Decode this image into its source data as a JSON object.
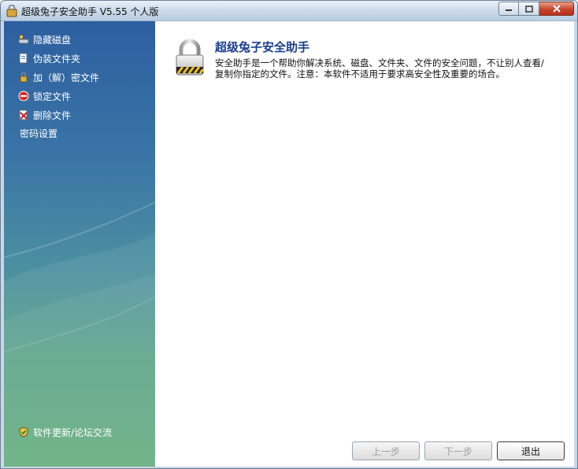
{
  "window": {
    "title": "超级兔子安全助手 V5.55 个人版"
  },
  "sidebar": {
    "items": [
      {
        "label": "隐藏磁盘",
        "icon": "disk-icon"
      },
      {
        "label": "伪装文件夹",
        "icon": "folder-icon"
      },
      {
        "label": "加（解）密文件",
        "icon": "lock-small-icon"
      },
      {
        "label": "锁定文件",
        "icon": "block-icon"
      },
      {
        "label": "删除文件",
        "icon": "delete-file-icon"
      },
      {
        "label": "密码设置",
        "icon": ""
      }
    ],
    "footer_link": "软件更新/论坛交流"
  },
  "main": {
    "heading": "超级兔子安全助手",
    "description": "安全助手是一个帮助你解决系统、磁盘、文件夹、文件的安全问题，不让别人查看/复制你指定的文件。注意：本软件不适用于要求高安全性及重要的场合。"
  },
  "buttons": {
    "prev": "上一步",
    "next": "下一步",
    "exit": "退出"
  },
  "colors": {
    "heading": "#1a3f8c",
    "sidebar_top": "#2c5fa0",
    "sidebar_bottom": "#5fab78"
  }
}
